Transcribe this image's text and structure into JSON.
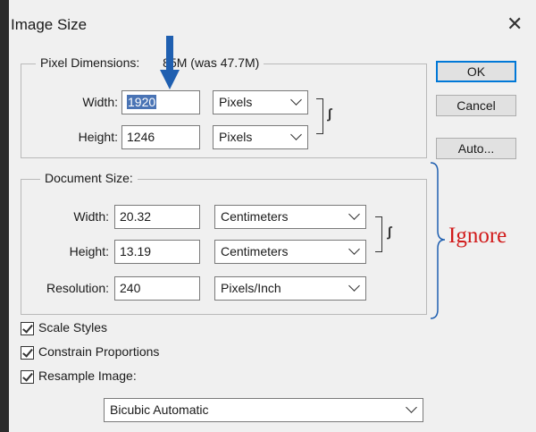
{
  "dialog": {
    "title": "Image Size"
  },
  "pixel_dimensions": {
    "legend": "Pixel Dimensions:",
    "size_text": "85M (was 47.7M)",
    "width": {
      "label": "Width:",
      "value": "1920",
      "unit": "Pixels"
    },
    "height": {
      "label": "Height:",
      "value": "1246",
      "unit": "Pixels"
    }
  },
  "document_size": {
    "legend": "Document Size:",
    "width": {
      "label": "Width:",
      "value": "20.32",
      "unit": "Centimeters"
    },
    "height": {
      "label": "Height:",
      "value": "13.19",
      "unit": "Centimeters"
    },
    "resolution": {
      "label": "Resolution:",
      "value": "240",
      "unit": "Pixels/Inch"
    }
  },
  "buttons": {
    "ok": "OK",
    "cancel": "Cancel",
    "auto": "Auto..."
  },
  "options": {
    "scale_styles": {
      "label": "Scale Styles",
      "checked": true
    },
    "constrain_proportions": {
      "label": "Constrain Proportions",
      "checked": true
    },
    "resample_image": {
      "label": "Resample Image:",
      "checked": true
    },
    "resample_method": "Bicubic Automatic"
  },
  "annotation": {
    "text": "Ignore",
    "color": "#d11a1a",
    "arrow_color": "#1f5fb0"
  }
}
